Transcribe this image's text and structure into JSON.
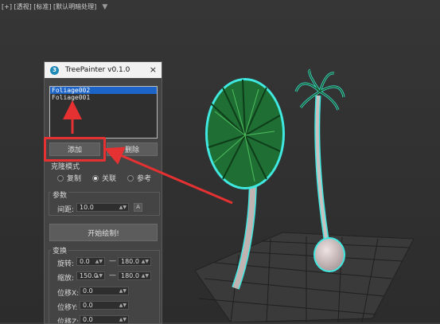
{
  "viewport": {
    "label": "[+] [透视] [标准] [默认明暗处理]",
    "filter_icon": "filter-icon"
  },
  "window": {
    "title": "TreePainter v0.1.0",
    "app_icon_glyph": "3"
  },
  "list": {
    "items": [
      {
        "label": "Foliage002",
        "selected": true
      },
      {
        "label": "Foliage001",
        "selected": false
      }
    ]
  },
  "buttons": {
    "add": "添加",
    "delete": "删除",
    "start_paint": "开始绘制!"
  },
  "clone_mode": {
    "title": "克隆模式",
    "options": [
      {
        "label": "复制",
        "selected": false
      },
      {
        "label": "关联",
        "selected": true
      },
      {
        "label": "参考",
        "selected": false
      }
    ]
  },
  "params": {
    "title": "参数",
    "spacing_label": "间距:",
    "spacing_value": "10.0",
    "toggle_label": "A"
  },
  "transform": {
    "title": "变换",
    "rotate_label": "旋转:",
    "rotate_min": "0.0",
    "rotate_max": "180.0",
    "scale_label": "缩放:",
    "scale_min": "150.0",
    "scale_max": "180.0",
    "dash": "—",
    "offset_x_label": "位移X:",
    "offset_x": "0.0",
    "offset_y_label": "位移Y:",
    "offset_y": "0.0",
    "offset_z_label": "位移Z:",
    "offset_z": "0.0"
  },
  "colors": {
    "annotation": "#e53131",
    "selection": "#1c64c8",
    "outline": "#3fe8e0"
  }
}
